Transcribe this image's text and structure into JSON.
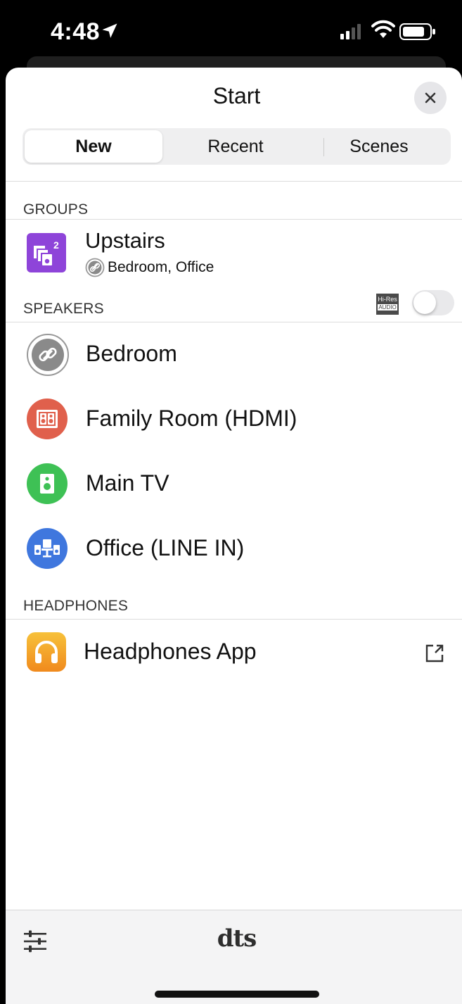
{
  "status_bar": {
    "time": "4:48"
  },
  "sheet": {
    "title": "Start",
    "tabs": [
      {
        "label": "New",
        "active": true
      },
      {
        "label": "Recent",
        "active": false
      },
      {
        "label": "Scenes",
        "active": false
      }
    ]
  },
  "groups": {
    "header": "GROUPS",
    "items": [
      {
        "name": "Upstairs",
        "badge": "2",
        "members": "Bedroom, Office",
        "icon": "group-speakers-icon",
        "color": "#8e44d9"
      }
    ]
  },
  "speakers": {
    "header": "SPEAKERS",
    "hires_top": "Hi-Res",
    "hires_bottom": "AUDIO",
    "hires_enabled": false,
    "items": [
      {
        "name": "Bedroom",
        "icon": "link-icon",
        "color": "#ffffff"
      },
      {
        "name": "Family Room (HDMI)",
        "icon": "family-room-icon",
        "color": "#e0604c"
      },
      {
        "name": "Main TV",
        "icon": "speaker-icon",
        "color": "#3ec155"
      },
      {
        "name": "Office (LINE IN)",
        "icon": "office-icon",
        "color": "#3f77de"
      }
    ]
  },
  "headphones": {
    "header": "HEADPHONES",
    "items": [
      {
        "name": "Headphones App",
        "icon": "headphones-icon",
        "color": "#f5a623"
      }
    ]
  },
  "bottom_bar": {
    "logo": "dts"
  }
}
